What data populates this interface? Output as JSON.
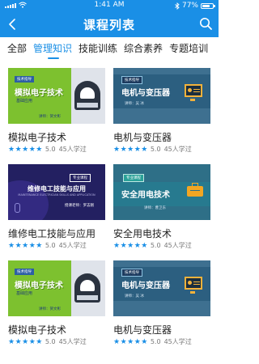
{
  "status_bar": {
    "time": "1:41 AM",
    "battery": "77%",
    "battery_level": 0.77
  },
  "header": {
    "title": "课程列表"
  },
  "tabs": [
    {
      "label": "全部"
    },
    {
      "label": "管理知识",
      "active": true
    },
    {
      "label": "技能训练"
    },
    {
      "label": "综合素养"
    },
    {
      "label": "专题培训"
    }
  ],
  "courses": [
    {
      "title": "模拟电子技术",
      "stars": "★★★★★",
      "score": "5.0",
      "learners": "45人学过",
      "thumb": {
        "tag": "技术指导",
        "heading": "模拟电子技术",
        "sub": "基础应用",
        "lecturer": "讲师：贺文彰"
      }
    },
    {
      "title": "电机与变压器",
      "stars": "★★★★★",
      "score": "5.0",
      "learners": "45人学过",
      "thumb": {
        "tag": "技术指导",
        "heading": "电机与变压器",
        "lecturer": "讲师：吴 冰"
      }
    },
    {
      "title": "维修电工技能与应用",
      "stars": "★★★★★",
      "score": "5.0",
      "learners": "45人学过",
      "thumb": {
        "tag": "专业课程",
        "heading": "维修电工技能与应用",
        "en": "MAINTENANCE ELECTRICIAN SKILLS AND APPLICATION",
        "lecturer": "授课老师：罗志刚"
      }
    },
    {
      "title": "安全用电技术",
      "stars": "★★★★★",
      "score": "5.0",
      "learners": "45人学过",
      "thumb": {
        "tag": "专业课程",
        "heading": "安全用电技术",
        "lecturer": "讲师：曹卫东"
      }
    },
    {
      "title": "模拟电子技术",
      "stars": "★★★★★",
      "score": "5.0",
      "learners": "45人学过",
      "thumb": {
        "tag": "技术指导",
        "heading": "模拟电子技术",
        "sub": "基础应用",
        "lecturer": "讲师：贺文彰"
      }
    },
    {
      "title": "电机与变压器",
      "stars": "★★★★★",
      "score": "5.0",
      "learners": "45人学过",
      "thumb": {
        "tag": "技术指导",
        "heading": "电机与变压器",
        "lecturer": "讲师：吴 冰"
      }
    }
  ],
  "colors": {
    "brand": "#1a8fe6",
    "text": "#222222",
    "muted": "#777777"
  },
  "icons": {
    "back": "chevron-left-icon",
    "search": "search-icon",
    "wifi": "wifi-icon",
    "signal": "signal-icon",
    "battery": "battery-icon"
  }
}
